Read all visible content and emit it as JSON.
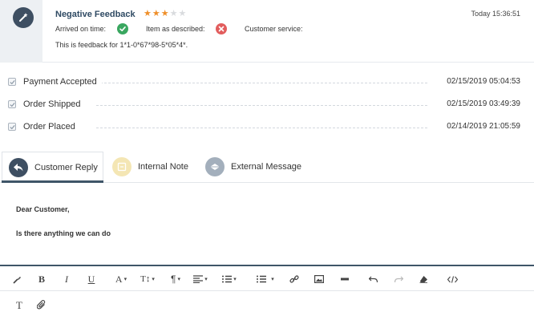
{
  "feedback": {
    "title": "Negative Feedback",
    "rating": 3,
    "rating_max": 5,
    "timestamp": "Today 15:36:51",
    "arrived_label": "Arrived on time:",
    "arrived_status": "ok",
    "described_label": "Item as described:",
    "described_status": "bad",
    "service_label": "Customer service:",
    "text": "This is feedback for 1*1-0*67*98-5*05*4*.",
    "colors": {
      "avatar": "#3e4f62",
      "title": "#2f4a63",
      "star": "#ef8f2a",
      "ok": "#3aa760",
      "bad": "#e25d5d"
    }
  },
  "history": [
    {
      "label": "Payment Accepted",
      "date": "02/15/2019 05:04:53"
    },
    {
      "label": "Order Shipped",
      "date": "02/15/2019 03:49:39"
    },
    {
      "label": "Order Placed",
      "date": "02/14/2019 21:05:59"
    }
  ],
  "tabs": [
    {
      "label": "Customer Reply",
      "icon": "reply-icon",
      "active": true
    },
    {
      "label": "Internal Note",
      "icon": "note-icon",
      "active": false
    },
    {
      "label": "External Message",
      "icon": "external-message-icon",
      "active": false
    }
  ],
  "editor": {
    "lines": [
      "Dear Customer,",
      "Is there anything we can do"
    ]
  },
  "toolbar": {
    "bold": "B",
    "italic": "I",
    "underline": "U",
    "font": "A",
    "font_size": "T↕",
    "paragraph": "¶",
    "caret": "▾",
    "text_icon": "T",
    "icons": [
      "format-brush-icon",
      "bold-icon",
      "italic-icon",
      "underline-icon",
      "font-color-icon",
      "font-size-icon",
      "paragraph-icon",
      "align-icon",
      "ordered-list-icon",
      "unordered-list-icon",
      "link-icon",
      "image-icon",
      "horizontal-rule-icon",
      "undo-icon",
      "redo-icon",
      "eraser-icon",
      "code-view-icon",
      "text-icon",
      "attachment-icon"
    ]
  }
}
